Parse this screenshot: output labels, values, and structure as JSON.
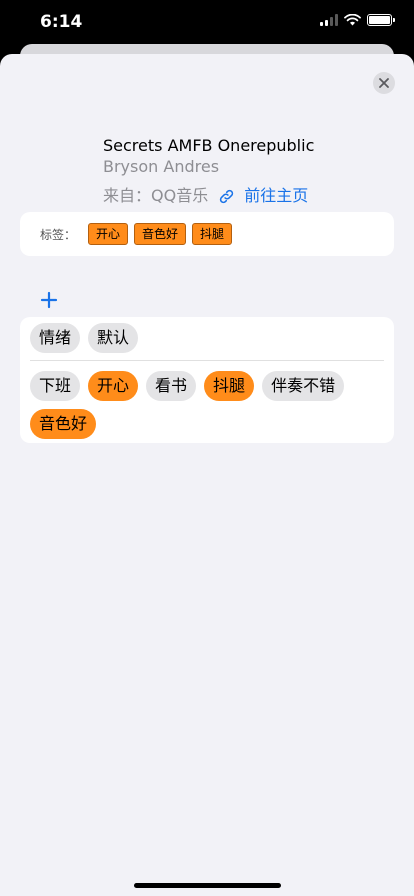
{
  "status_bar": {
    "time": "6:14"
  },
  "song": {
    "title": "Secrets AMFB Onerepublic",
    "artist": "Bryson Andres",
    "source_label": "来自：QQ音乐",
    "homepage_link": "前往主页"
  },
  "tags_summary": {
    "label": "标签：",
    "tags": [
      "开心",
      "音色好",
      "抖腿"
    ]
  },
  "groups": [
    "情绪",
    "默认"
  ],
  "tag_options": [
    {
      "label": "下班",
      "selected": false
    },
    {
      "label": "开心",
      "selected": true
    },
    {
      "label": "看书",
      "selected": false
    },
    {
      "label": "抖腿",
      "selected": true
    },
    {
      "label": "伴奏不错",
      "selected": false
    },
    {
      "label": "音色好",
      "selected": true
    }
  ],
  "colors": {
    "accent_orange": "#ff8c1a",
    "link_blue": "#1a73e8",
    "chip_gray": "#e4e4e6",
    "sheet_background": "#f2f2f7"
  }
}
